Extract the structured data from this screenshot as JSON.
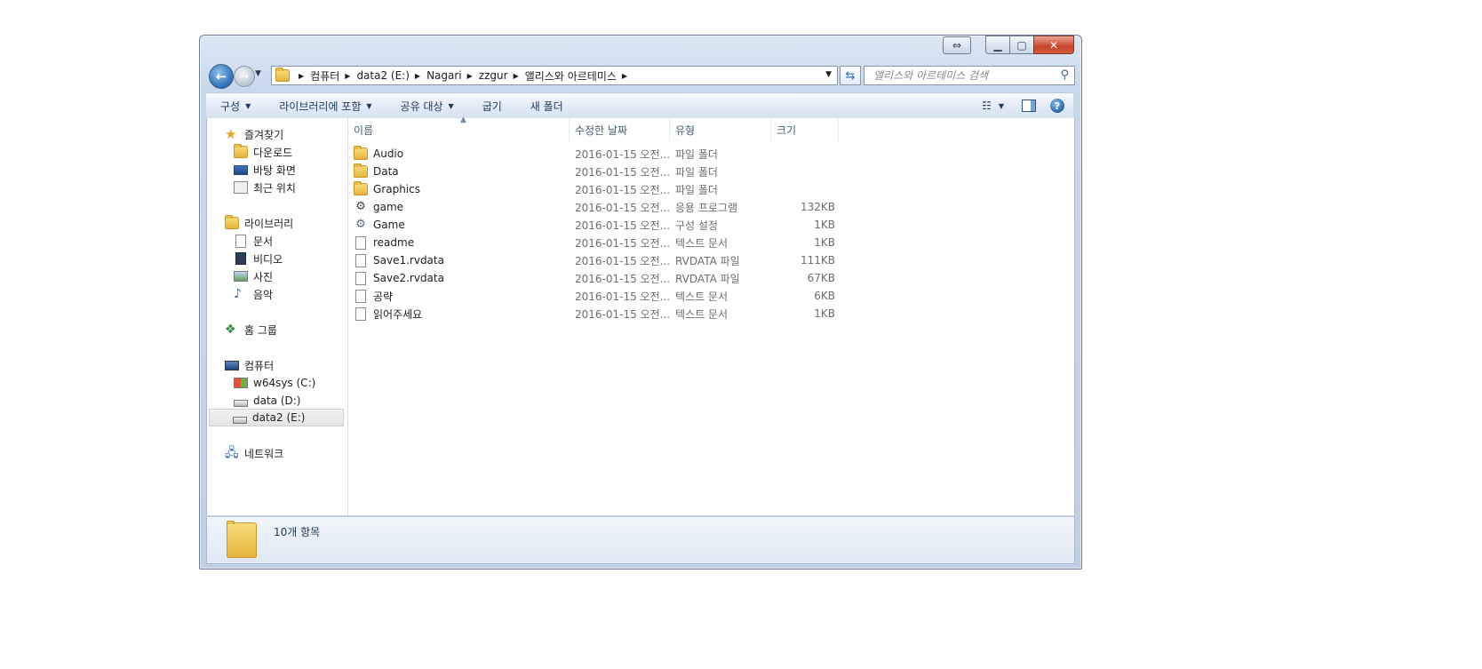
{
  "window": {
    "buttons": {
      "special": "⇔",
      "minimize": "▁",
      "maximize": "▢",
      "close": "✕"
    }
  },
  "address": {
    "crumbs": [
      "컴퓨터",
      "data2 (E:)",
      "Nagari",
      "zzgur",
      "앨리스와 아르테미스"
    ]
  },
  "search": {
    "placeholder": "앨리스와 아르테미스 검색"
  },
  "toolbar": {
    "organize": "구성",
    "include_library": "라이브러리에 포함",
    "share": "공유 대상",
    "burn": "굽기",
    "new_folder": "새 폴더"
  },
  "nav": {
    "favorites": "즐겨찾기",
    "downloads": "다운로드",
    "desktop": "바탕 화면",
    "recent": "최근 위치",
    "libraries": "라이브러리",
    "documents": "문서",
    "videos": "비디오",
    "pictures": "사진",
    "music": "음악",
    "homegroup": "홈 그룹",
    "computer": "컴퓨터",
    "drive_c": "w64sys (C:)",
    "drive_d": "data (D:)",
    "drive_e": "data2 (E:)",
    "network": "네트워크"
  },
  "columns": {
    "name": "이름",
    "date": "수정한 날짜",
    "type": "유형",
    "size": "크기"
  },
  "files": [
    {
      "name": "Audio",
      "date": "2016-01-15 오전...",
      "type": "파일 폴더",
      "size": "",
      "icon": "folder-icon"
    },
    {
      "name": "Data",
      "date": "2016-01-15 오전...",
      "type": "파일 폴더",
      "size": "",
      "icon": "folder-icon"
    },
    {
      "name": "Graphics",
      "date": "2016-01-15 오전...",
      "type": "파일 폴더",
      "size": "",
      "icon": "folder-icon"
    },
    {
      "name": "game",
      "date": "2016-01-15 오전...",
      "type": "응용 프로그램",
      "size": "132KB",
      "icon": "application-icon"
    },
    {
      "name": "Game",
      "date": "2016-01-15 오전...",
      "type": "구성 설정",
      "size": "1KB",
      "icon": "settings-file-icon"
    },
    {
      "name": "readme",
      "date": "2016-01-15 오전...",
      "type": "텍스트 문서",
      "size": "1KB",
      "icon": "text-file-icon"
    },
    {
      "name": "Save1.rvdata",
      "date": "2016-01-15 오전...",
      "type": "RVDATA 파일",
      "size": "111KB",
      "icon": "file-icon"
    },
    {
      "name": "Save2.rvdata",
      "date": "2016-01-15 오전...",
      "type": "RVDATA 파일",
      "size": "67KB",
      "icon": "file-icon"
    },
    {
      "name": "공략",
      "date": "2016-01-15 오전...",
      "type": "텍스트 문서",
      "size": "6KB",
      "icon": "text-file-icon"
    },
    {
      "name": "읽어주세요",
      "date": "2016-01-15 오전...",
      "type": "텍스트 문서",
      "size": "1KB",
      "icon": "text-file-icon"
    }
  ],
  "details": {
    "count": "10개 항목"
  }
}
